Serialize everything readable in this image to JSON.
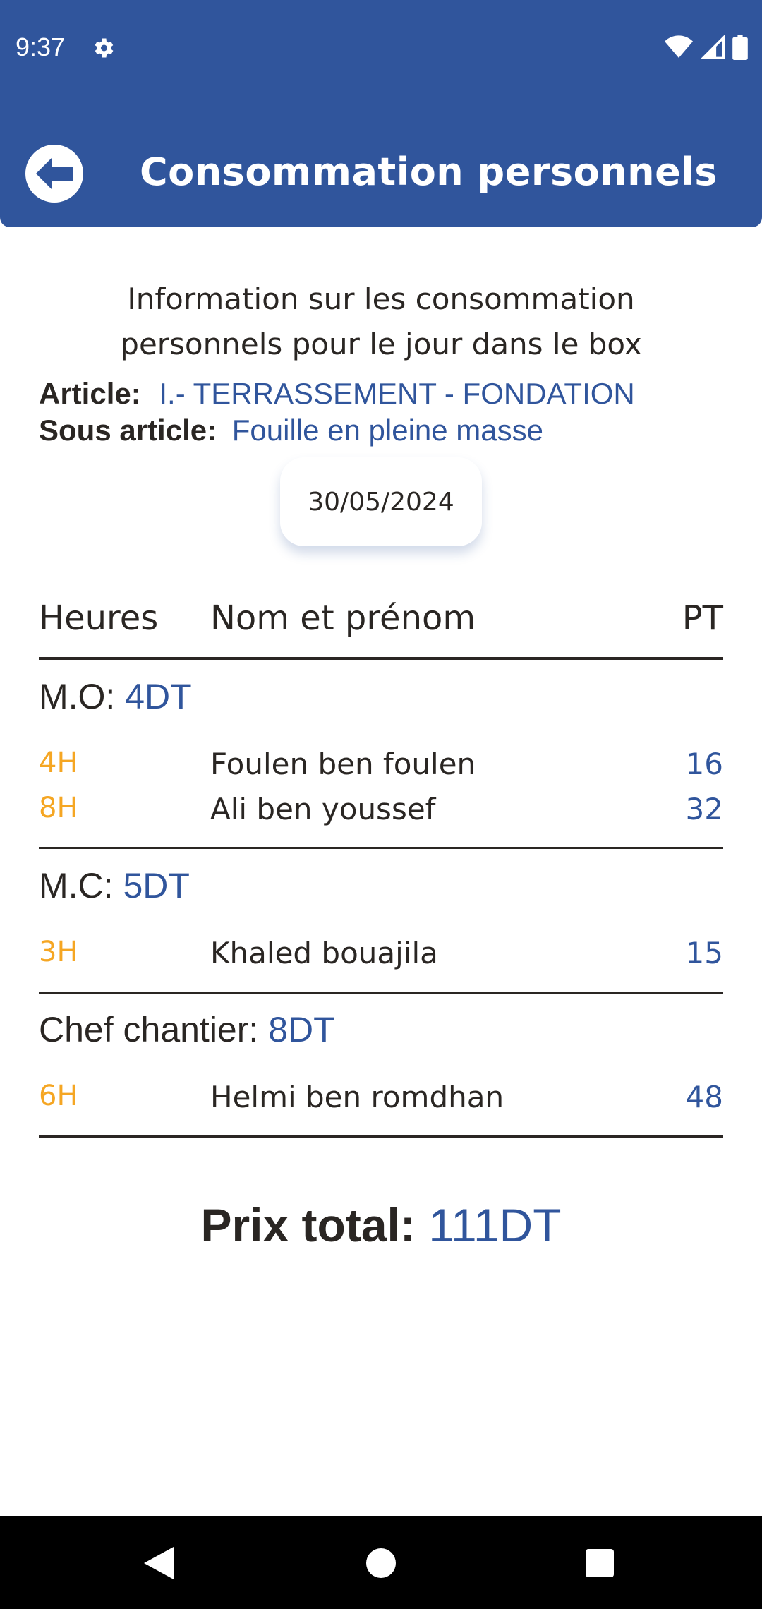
{
  "status_bar": {
    "time": "9:37"
  },
  "header": {
    "title": "Consommation personnels"
  },
  "intro": {
    "line1": "Information sur les consommation",
    "line2": "personnels pour le jour dans le box"
  },
  "article": {
    "label": "Article:",
    "value": "I.- TERRASSEMENT - FONDATION"
  },
  "sous_article": {
    "label": "Sous article:",
    "value": "Fouille en pleine masse"
  },
  "date": "30/05/2024",
  "columns": {
    "hours": "Heures",
    "name": "Nom et prénom",
    "pt": "PT"
  },
  "groups": [
    {
      "label": "M.O:",
      "rate": "4DT",
      "rows": [
        {
          "hours": "4H",
          "name": "Foulen ben foulen",
          "pt": "16"
        },
        {
          "hours": "8H",
          "name": "Ali ben youssef",
          "pt": "32"
        }
      ]
    },
    {
      "label": "M.C:",
      "rate": "5DT",
      "rows": [
        {
          "hours": "3H",
          "name": "Khaled bouajila",
          "pt": "15"
        }
      ]
    },
    {
      "label": "Chef chantier:",
      "rate": "8DT",
      "rows": [
        {
          "hours": "6H",
          "name": "Helmi ben romdhan",
          "pt": "48"
        }
      ]
    }
  ],
  "total": {
    "label": "Prix total:",
    "value": "111DT"
  },
  "colors": {
    "primary": "#30559c",
    "accent": "#f5a623",
    "text": "#2a2623"
  },
  "icons": {
    "status": [
      "gear-icon",
      "wifi-icon",
      "signal-icon",
      "battery-icon"
    ],
    "header": "arrow-left-icon",
    "nav": [
      "back-triangle-icon",
      "home-circle-icon",
      "recents-square-icon"
    ]
  }
}
